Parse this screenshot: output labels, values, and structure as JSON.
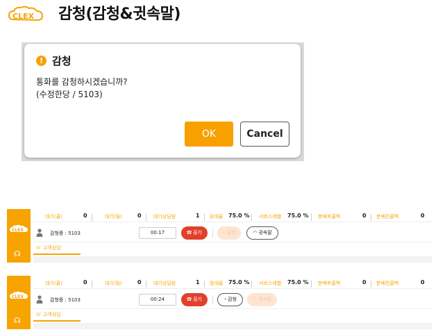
{
  "page": {
    "title": "감청(감청&귓속말)",
    "logo_text": "CLEX"
  },
  "dialog": {
    "title": "감청",
    "message_line1": "통화를 감청하시겠습니까?",
    "message_line2": "(수정한당 / 5103)",
    "ok_label": "OK",
    "cancel_label": "Cancel"
  },
  "stats_labels": {
    "wait_group": "대기(콜)",
    "wait_team": "대기(팀)",
    "wait_agents": "대기상담원",
    "answer_rate": "응대율",
    "service_level": "서비스레벨",
    "missed_calls": "분배후콜백",
    "transfer_calls": "분배전콜백"
  },
  "panels": [
    {
      "stats": {
        "wait_group": "0",
        "wait_team": "0",
        "wait_agents": "1",
        "answer_rate": "75.0 %",
        "service_level": "75.0 %",
        "missed_calls": "0",
        "transfer_calls": "0"
      },
      "agent_status": "감청중 : 5103",
      "timer": "00:17",
      "hangup_label": "끊기",
      "listen_label": "감청",
      "whisper_label": "귓속말",
      "tab_label": "고객상담"
    },
    {
      "stats": {
        "wait_group": "0",
        "wait_team": "0",
        "wait_agents": "1",
        "answer_rate": "75.0 %",
        "service_level": "75.0 %",
        "missed_calls": "0",
        "transfer_calls": "0"
      },
      "agent_status": "감청중 : 5103",
      "timer": "00:24",
      "hangup_label": "끊기",
      "listen_label": "감청",
      "whisper_label": "귓속말",
      "tab_label": "고객상담"
    }
  ],
  "colors": {
    "accent": "#f7a300",
    "hangup": "#e2402b",
    "disabled": "#fde5d2"
  }
}
